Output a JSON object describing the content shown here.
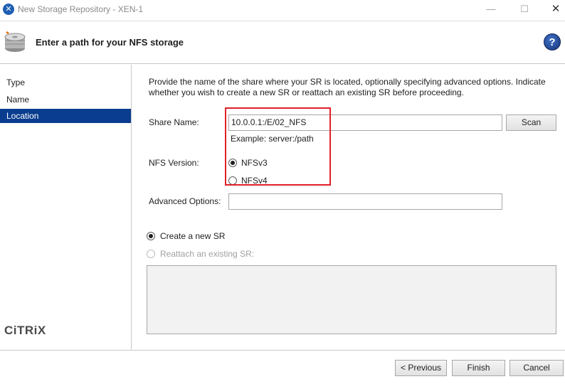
{
  "window": {
    "title": "New Storage Repository - XEN-1",
    "min_glyph": "—",
    "max_glyph": "☐",
    "close_glyph": "✕",
    "app_icon_glyph": "✕"
  },
  "header": {
    "heading": "Enter a path for your NFS storage",
    "help_glyph": "?"
  },
  "sidebar": {
    "items": [
      {
        "label": "Type",
        "selected": false
      },
      {
        "label": "Name",
        "selected": false
      },
      {
        "label": "Location",
        "selected": true
      }
    ],
    "logo_text": "CiTRiX"
  },
  "main": {
    "intro": "Provide the name of the share where your SR is located, optionally specifying advanced options. Indicate whether you wish to create a new SR or reattach an existing SR before proceeding.",
    "share_name_label": "Share Name:",
    "share_name_value": "10.0.0.1:/E/02_NFS",
    "scan_label": "Scan",
    "example_text": "Example: server:/path",
    "nfs_version_label": "NFS Version:",
    "nfs_options": [
      {
        "label": "NFSv3",
        "checked": true
      },
      {
        "label": "NFSv4",
        "checked": false
      }
    ],
    "advanced_label": "Advanced Options:",
    "advanced_value": "",
    "create_new_label": "Create a new SR",
    "reattach_label": "Reattach an existing SR:",
    "create_new_checked": true,
    "reattach_enabled": false
  },
  "footer": {
    "previous_label": "< Previous",
    "finish_label": "Finish",
    "cancel_label": "Cancel"
  },
  "colors": {
    "selection": "#0a3d8f",
    "highlight_box": "#e0202a",
    "help_icon": "#2a55a8"
  }
}
